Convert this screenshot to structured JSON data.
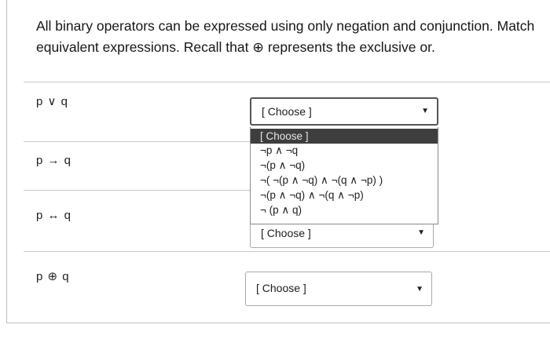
{
  "question": {
    "line1": "All binary operators can be expressed using only negation and conjunction. Match",
    "line2": "equivalent expressions. Recall that ⊕ represents the exclusive or."
  },
  "rows": [
    {
      "prompt": "p ∨ q",
      "selected": "[ Choose ]"
    },
    {
      "prompt": "p → q",
      "selected": ""
    },
    {
      "prompt": "p ↔ q",
      "selected": "[ Choose ]"
    },
    {
      "prompt": "p ⊕ q",
      "selected": "[ Choose ]"
    }
  ],
  "dropdown": {
    "options": [
      "[ Choose ]",
      "¬p ∧ ¬q",
      "¬(p ∧ ¬q)",
      "¬( ¬(p ∧ ¬q) ∧ ¬(q ∧ ¬p) )",
      "¬(p ∧ ¬q) ∧ ¬(q ∧ ¬p)",
      "¬ (p ∧ q)"
    ],
    "highlighted_index": 0
  },
  "icons": {
    "dropdown_arrow": "caret-down-icon"
  }
}
